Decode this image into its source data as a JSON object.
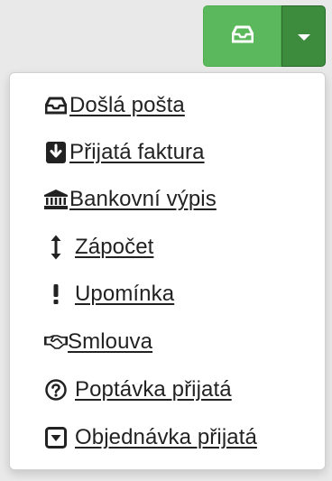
{
  "button": {
    "main_icon": "inbox-icon",
    "toggle_icon": "caret-down-icon"
  },
  "menu": {
    "items": [
      {
        "label": "Došlá pošta",
        "icon": "inbox-icon"
      },
      {
        "label": "Přijatá faktura",
        "icon": "download-square-icon"
      },
      {
        "label": "Bankovní výpis",
        "icon": "bank-icon"
      },
      {
        "label": "Zápočet",
        "icon": "vertical-arrows-icon"
      },
      {
        "label": "Upomínka",
        "icon": "exclamation-icon"
      },
      {
        "label": "Smlouva",
        "icon": "handshake-icon"
      },
      {
        "label": "Poptávka přijatá",
        "icon": "question-circle-icon"
      },
      {
        "label": "Objednávka přijatá",
        "icon": "caret-square-down-icon"
      }
    ]
  },
  "colors": {
    "button_green": "#5cb85c",
    "toggle_green": "#3d8b3d",
    "menu_background": "#ffffff",
    "page_background": "#e9e9e9",
    "text": "#222222"
  }
}
